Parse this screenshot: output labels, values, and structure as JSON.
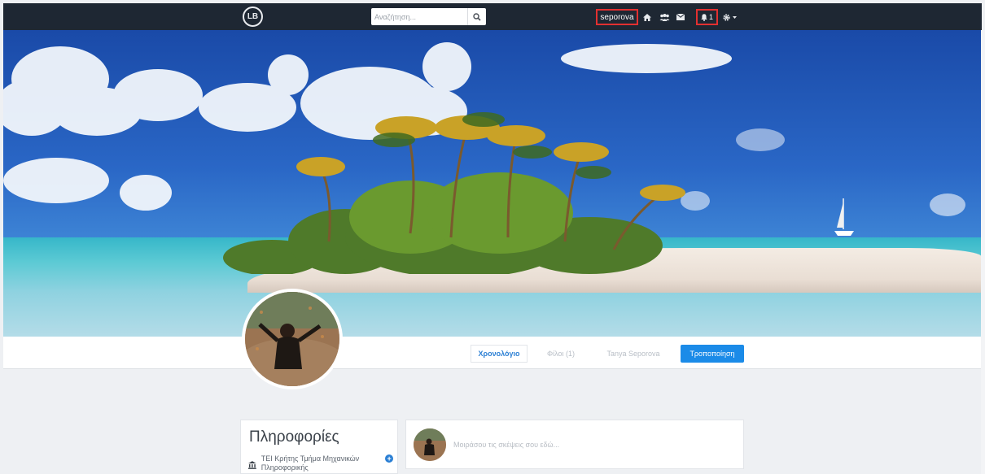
{
  "nav": {
    "logo_text": "LB",
    "search_placeholder": "Αναζήτηση...",
    "username": "seporova",
    "notification_count": "1"
  },
  "icons": {
    "search": "search-icon",
    "home": "home-icon",
    "friends": "users-icon",
    "messages": "envelope-icon",
    "notifications": "bell-icon",
    "settings": "gear-icon",
    "dropdown": "caret-down-icon",
    "institution": "university-icon",
    "add": "plus-circle-icon"
  },
  "colors": {
    "navbar": "#1e2733",
    "highlight_border": "#e23030",
    "accent": "#1b8be8",
    "tab_active": "#2b7fd4"
  },
  "profile_tabs": {
    "timeline": "Χρονολόγιο",
    "friends": "Φίλοι (1)",
    "about": "Tanya Seporova",
    "edit": "Τροποποίηση"
  },
  "info": {
    "title": "Πληροφορίες",
    "institution": "ΤΕΙ Κρήτης Τμήμα Μηχανικών Πληροφορικής"
  },
  "composer": {
    "placeholder": "Μοιράσου τις σκέψεις σου εδώ..."
  }
}
